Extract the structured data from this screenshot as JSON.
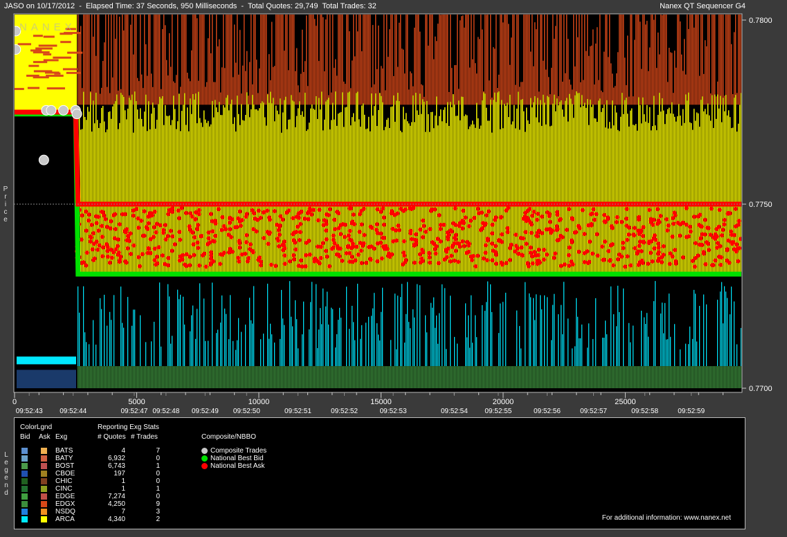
{
  "header": {
    "left": "JASO on 10/17/2012  -  Elapsed Time: 37 Seconds, 950 Milliseconds  -  Total Quotes: 29,749  Total Trades: 32",
    "right": "Nanex QT Sequencer G4"
  },
  "watermark": "NANEX",
  "chart_data": {
    "type": "area",
    "title": "JASO on 10/17/2012",
    "ylabel": "Price",
    "ylim": [
      0.77,
      0.78
    ],
    "yticks": [
      "0.7800",
      "0.7750",
      "0.7700"
    ],
    "xlim": [
      0,
      29749
    ],
    "xticks_seq": [
      {
        "v": 0,
        "label": "0"
      },
      {
        "v": 5000,
        "label": "5000"
      },
      {
        "v": 10000,
        "label": "10000"
      },
      {
        "v": 15000,
        "label": "15000"
      },
      {
        "v": 20000,
        "label": "20000"
      },
      {
        "v": 25000,
        "label": "25000"
      }
    ],
    "xticks_time": [
      {
        "v": 600,
        "label": "09:52:43"
      },
      {
        "v": 2400,
        "label": "09:52:44"
      },
      {
        "v": 4900,
        "label": "09:52:47"
      },
      {
        "v": 6200,
        "label": "09:52:48"
      },
      {
        "v": 7800,
        "label": "09:52:49"
      },
      {
        "v": 9500,
        "label": "09:52:50"
      },
      {
        "v": 11600,
        "label": "09:52:51"
      },
      {
        "v": 13500,
        "label": "09:52:52"
      },
      {
        "v": 15500,
        "label": "09:52:53"
      },
      {
        "v": 18000,
        "label": "09:52:54"
      },
      {
        "v": 19800,
        "label": "09:52:55"
      },
      {
        "v": 21800,
        "label": "09:52:56"
      },
      {
        "v": 23700,
        "label": "09:52:57"
      },
      {
        "v": 25800,
        "label": "09:52:58"
      },
      {
        "v": 27700,
        "label": "09:52:59"
      }
    ],
    "series": [
      {
        "name": "National Best Bid",
        "points": [
          [
            0,
            0.77745
          ],
          [
            2500,
            0.77745
          ],
          [
            2600,
            0.7731
          ],
          [
            29749,
            0.7731
          ]
        ]
      },
      {
        "name": "National Best Ask",
        "points": [
          [
            0,
            0.7775
          ],
          [
            2500,
            0.7775
          ],
          [
            2600,
            0.775
          ],
          [
            29749,
            0.775
          ]
        ]
      },
      {
        "name": "Composite Trades",
        "points": [
          [
            50,
            0.7797
          ],
          [
            50,
            0.7792
          ],
          [
            1200,
            0.7762
          ],
          [
            1300,
            0.77755
          ],
          [
            1500,
            0.77755
          ],
          [
            2000,
            0.77755
          ],
          [
            2500,
            0.77755
          ],
          [
            2550,
            0.77745
          ]
        ]
      }
    ]
  },
  "legend": {
    "title": "Legend",
    "colorlegend_label": "ColorLgnd",
    "col_bid": "Bid",
    "col_ask": "Ask",
    "col_exg": "Exg",
    "stats_label": "Reporting Exg Stats",
    "col_quotes": "# Quotes",
    "col_trades": "# Trades",
    "composite_label": "Composite/NBBO",
    "rows": [
      {
        "exg": "BATS",
        "quotes": "4",
        "trades": "7",
        "bid": "#5b8fd0",
        "ask": "#f0b050"
      },
      {
        "exg": "BATY",
        "quotes": "6,932",
        "trades": "0",
        "bid": "#6aa0c8",
        "ask": "#d06040"
      },
      {
        "exg": "BOST",
        "quotes": "6,743",
        "trades": "1",
        "bid": "#4a9a4a",
        "ask": "#c05050"
      },
      {
        "exg": "CBOE",
        "quotes": "197",
        "trades": "0",
        "bid": "#2050b0",
        "ask": "#a08020"
      },
      {
        "exg": "CHIC",
        "quotes": "1",
        "trades": "0",
        "bid": "#206020",
        "ask": "#804020"
      },
      {
        "exg": "CINC",
        "quotes": "1",
        "trades": "1",
        "bid": "#207030",
        "ask": "#90a020"
      },
      {
        "exg": "EDGE",
        "quotes": "7,274",
        "trades": "0",
        "bid": "#40a040",
        "ask": "#c05048"
      },
      {
        "exg": "EDGX",
        "quotes": "4,250",
        "trades": "9",
        "bid": "#3c8c3c",
        "ask": "#d84818"
      },
      {
        "exg": "NSDQ",
        "quotes": "7",
        "trades": "3",
        "bid": "#2080e0",
        "ask": "#f09020"
      },
      {
        "exg": "ARCA",
        "quotes": "4,340",
        "trades": "2",
        "bid": "#00e8ff",
        "ask": "#ffff00"
      }
    ],
    "composite_items": [
      {
        "label": "Composite Trades",
        "color": "#c8c8c8"
      },
      {
        "label": "National Best Bid",
        "color": "#00e000"
      },
      {
        "label": "National Best Ask",
        "color": "#ff0000"
      }
    ],
    "info": "For additional information: www.nanex.net"
  },
  "colors": {
    "ask_upper": "#d84818",
    "ask_lower": "#ffff00",
    "bid_upper": "#00e8ff",
    "bid_lower": "#3c8c3c",
    "nbb": "#00e000",
    "nba": "#ff0000"
  }
}
